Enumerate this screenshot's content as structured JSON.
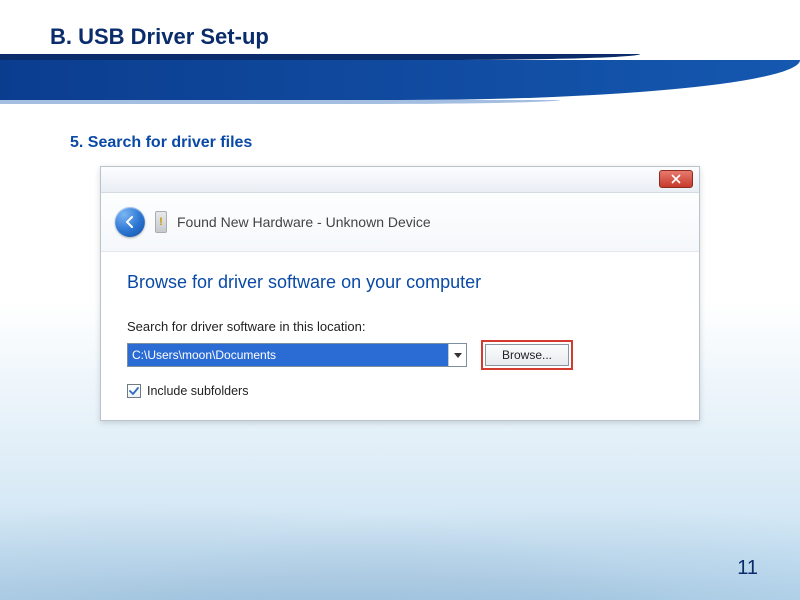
{
  "slide": {
    "title": "B. USB Driver Set-up",
    "step_label": "5. Search for driver files",
    "page_number": "11"
  },
  "dialog": {
    "header_title": "Found New Hardware - Unknown Device",
    "body_heading": "Browse for driver software on your computer",
    "field_label": "Search for driver software in this location:",
    "path_value": "C:\\Users\\moon\\Documents",
    "browse_label": "Browse...",
    "include_subfolders_label": "Include subfolders",
    "include_subfolders_checked": true
  }
}
